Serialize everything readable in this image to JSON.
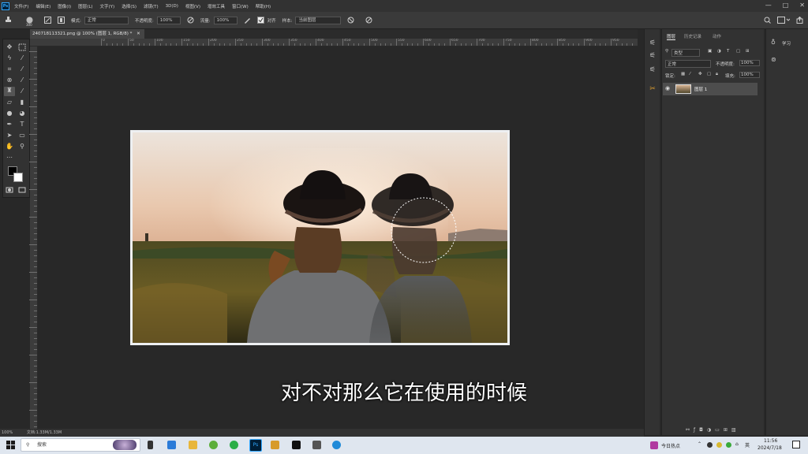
{
  "app": {
    "logo": "Ps",
    "name": "Adobe Photoshop"
  },
  "menu": [
    "文件(F)",
    "编辑(E)",
    "图像(I)",
    "图层(L)",
    "文字(Y)",
    "选择(S)",
    "滤镜(T)",
    "3D(D)",
    "视图(V)",
    "增效工具",
    "窗口(W)",
    "帮助(H)"
  ],
  "window_controls": {
    "minimize": "—",
    "maximize": "□",
    "close": "✕"
  },
  "options_bar": {
    "brush_size": "300",
    "mode_label": "模式:",
    "mode_value": "正常",
    "opacity_label": "不透明度:",
    "opacity_value": "100%",
    "flow_label": "流量:",
    "flow_value": "100%",
    "align_label": "对齐",
    "sample_label": "样本:",
    "sample_value": "当前图层"
  },
  "document_tab": {
    "title": "240718113321.png @ 100% (图层 1, RGB/8) *",
    "close": "✕"
  },
  "ruler": {
    "labels": [
      "0",
      "50",
      "100",
      "150",
      "200",
      "250",
      "300",
      "350",
      "400",
      "450",
      "500",
      "550",
      "600",
      "650",
      "700",
      "750",
      "800",
      "850",
      "900",
      "950",
      "1000",
      "1050",
      "1100",
      "1150"
    ]
  },
  "layers_panel": {
    "tabs": [
      "图层",
      "历史记录",
      "动作"
    ],
    "kind_label": "类型",
    "blend_mode": "正常",
    "opacity_label": "不透明度:",
    "opacity_value": "100%",
    "lock_label": "锁定:",
    "fill_label": "填充:",
    "fill_value": "100%",
    "layer_name": "图层 1"
  },
  "learn_panel": {
    "label": "学习"
  },
  "status": {
    "zoom": "100%",
    "doc_size": "文档:1.33M/1.33M"
  },
  "subtitle": "对不对那么它在使用的时候",
  "taskbar": {
    "search_placeholder": "搜索",
    "news": "今日热点",
    "ime": "英",
    "time": "11:56",
    "date": "2024/7/18"
  },
  "colors": {
    "ps_blue": "#31a8ff",
    "panel": "#323232",
    "canvas": "#282828",
    "taskbar": "#dfe6ef"
  }
}
